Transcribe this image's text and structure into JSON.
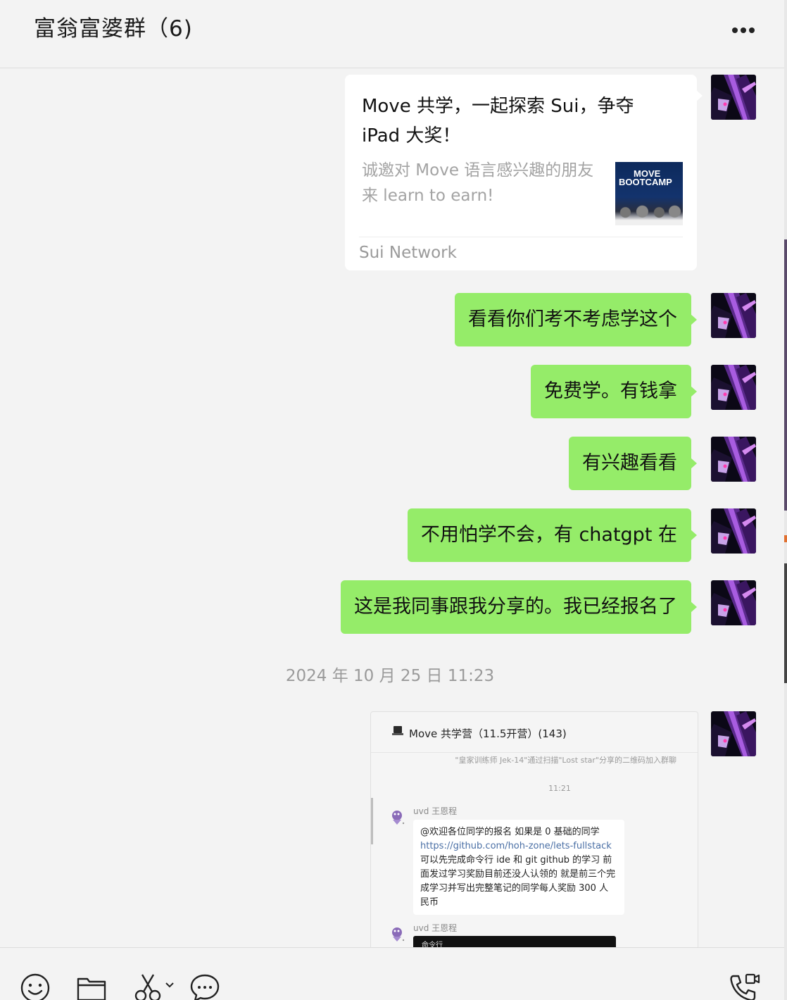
{
  "header": {
    "title": "富翁富婆群（6)"
  },
  "messages": {
    "link_card": {
      "title": "Move 共学，一起探索 Sui，争夺 iPad 大奖！",
      "description": "诚邀对 Move 语言感兴趣的朋友来 learn to earn!",
      "thumbnail_text_1": "MOVE",
      "thumbnail_text_2": "BOOTCAMP",
      "source": "Sui Network"
    },
    "texts": [
      "看看你们考不考虑学这个",
      "免费学。有钱拿",
      "有兴趣看看",
      "不用怕学不会，有 chatgpt 在",
      "这是我同事跟我分享的。我已经报名了"
    ],
    "timestamp": "2024 年 10 月 25 日 11:23",
    "screenshot": {
      "group_title": "Move 共学营（11.5开营）(143)",
      "system_notice": "\"皇家训练师 Jek-14\"通过扫描\"Lost star\"分享的二维码加入群聊",
      "time": "11:21",
      "sender_1": "uvd 王恩程",
      "message_prefix": "@欢迎各位同学的报名 如果是 0 基础的同学 ",
      "message_link": "https://github.com/hoh-zone/lets-fullstack",
      "message_suffix": " 可以先完成命令行 ide 和 git github 的学习 前面发过学习奖励目前还没人认领的 就是前三个完成学习并写出完整笔记的同学每人奖励 300 人民币",
      "sender_2": "uvd 王恩程",
      "dark_label": "命令行"
    }
  },
  "colors": {
    "bubble_green": "#95ec69",
    "background": "#f3f3f3",
    "card_white": "#ffffff"
  },
  "toolbar_icons": [
    "emoji-icon",
    "folder-icon",
    "scissors-icon",
    "chat-history-icon",
    "call-icon"
  ]
}
